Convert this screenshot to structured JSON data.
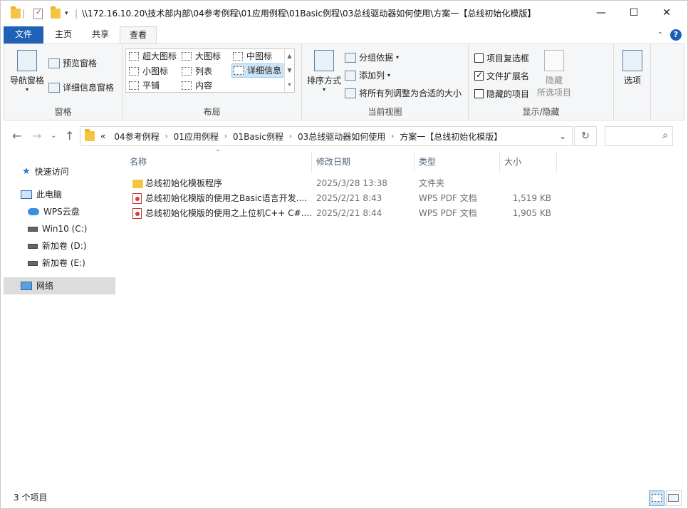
{
  "title": "\\\\172.16.10.20\\技术部内部\\04参考例程\\01应用例程\\01Basic例程\\03总线驱动器如何使用\\方案一【总线初始化模版】",
  "window_controls": {
    "minimize": "—",
    "maximize": "☐",
    "close": "✕"
  },
  "tabs": [
    "文件",
    "主页",
    "共享",
    "查看"
  ],
  "ribbon": {
    "pane_group": {
      "nav_pane": "导航窗格",
      "preview_pane": "预览窗格",
      "details_pane": "详细信息窗格",
      "label": "窗格"
    },
    "layout_group": {
      "items": [
        "超大图标",
        "大图标",
        "中图标",
        "小图标",
        "列表",
        "详细信息",
        "平铺",
        "内容"
      ],
      "selected": "详细信息",
      "label": "布局"
    },
    "current_view_group": {
      "sort_by": "排序方式",
      "group_by": "分组依据",
      "add_column": "添加列",
      "fit_columns": "将所有列调整为合适的大小",
      "label": "当前视图"
    },
    "show_hide_group": {
      "item_checkboxes": "项目复选框",
      "file_extensions": "文件扩展名",
      "hidden_items": "隐藏的项目",
      "hide_selected_line1": "隐藏",
      "hide_selected_line2": "所选项目",
      "label": "显示/隐藏"
    },
    "options": "选项"
  },
  "address": {
    "overflow": "«",
    "crumbs": [
      "04参考例程",
      "01应用例程",
      "01Basic例程",
      "03总线驱动器如何使用",
      "方案一【总线初始化模版】"
    ]
  },
  "nav_pane": {
    "quick_access": "快速访问",
    "this_pc": "此电脑",
    "wps_cloud": "WPS云盘",
    "drive_c": "Win10 (C:)",
    "drive_d": "新加卷 (D:)",
    "drive_e": "新加卷 (E:)",
    "network": "网络"
  },
  "columns": {
    "name": "名称",
    "modified": "修改日期",
    "type": "类型",
    "size": "大小"
  },
  "files": [
    {
      "name": "总线初始化模板程序",
      "modified": "2025/3/28 13:38",
      "type": "文件夹",
      "size": "",
      "icon": "folder-icon"
    },
    {
      "name": "总线初始化模版的使用之Basic语言开发....",
      "modified": "2025/2/21 8:43",
      "type": "WPS PDF 文档",
      "size": "1,519 KB",
      "icon": "pdf-icon"
    },
    {
      "name": "总线初始化模版的使用之上位机C++ C#....",
      "modified": "2025/2/21 8:44",
      "type": "WPS PDF 文档",
      "size": "1,905 KB",
      "icon": "pdf-icon"
    }
  ],
  "status": {
    "count": "3 个项目"
  },
  "colors": {
    "file_tab": "#1f61b6",
    "selection": "#cce4f7"
  }
}
